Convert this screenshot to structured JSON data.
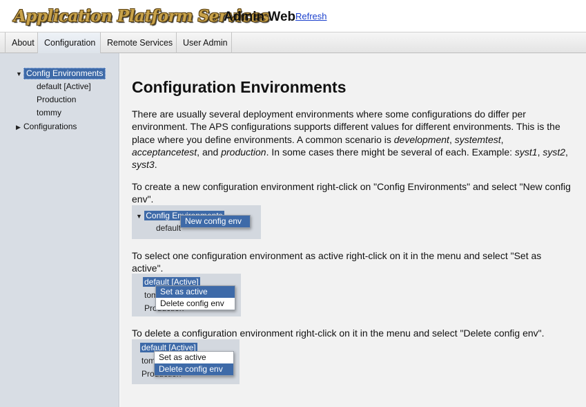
{
  "header": {
    "logo_text": "Application Platform Services",
    "app_title": "Admin Web",
    "refresh_label": "Refresh"
  },
  "tabs": [
    {
      "label": "About"
    },
    {
      "label": "Configuration",
      "active": true
    },
    {
      "label": "Remote Services"
    },
    {
      "label": "User Admin"
    }
  ],
  "sidebar": {
    "config_environments": "Config Environments",
    "environments": [
      "default [Active]",
      "Production",
      "tommy"
    ],
    "configurations": "Configurations"
  },
  "main": {
    "title": "Configuration Environments",
    "intro": {
      "t1": "There are usually several deployment environments where some configurations do differ per environment. The APS configurations supports different values for different environments. This is the place where you define environments. A common scenario is ",
      "e1": "development",
      "t2": ", ",
      "e2": "systemtest",
      "t3": ", ",
      "e3": "acceptancetest",
      "t4": ", and ",
      "e4": "production",
      "t5": ". In some cases there might be several of each. Example: ",
      "e5": "syst1",
      "t6": ", ",
      "e6": "syst2",
      "t7": ", ",
      "e7": "syst3",
      "t8": "."
    },
    "create_text": "To create a new configuration environment right-click on \"Config Environments\" and select \"New config env\".",
    "select_text": "To select one configuration environment as active right-click on it in the menu and select \"Set as active\".",
    "delete_text": "To delete a configuration environment right-click on it in the menu and select \"Delete config env\".",
    "example_create": {
      "node": "Config Environments",
      "child": "default",
      "menu": [
        "New config env"
      ]
    },
    "example_select": {
      "rows": [
        "default [Active]",
        "tommy",
        "Production"
      ],
      "menu": [
        "Set as active",
        "Delete config env"
      ]
    },
    "example_delete": {
      "rows": [
        "default [Active]",
        "tommy",
        "Production"
      ],
      "menu": [
        "Set as active",
        "Delete config env"
      ]
    }
  },
  "colors": {
    "selection": "#3e6aa8",
    "sidebar_bg": "#d8dde4",
    "content_bg": "#f2f2f2",
    "logo_gold": "#c8a24a"
  }
}
